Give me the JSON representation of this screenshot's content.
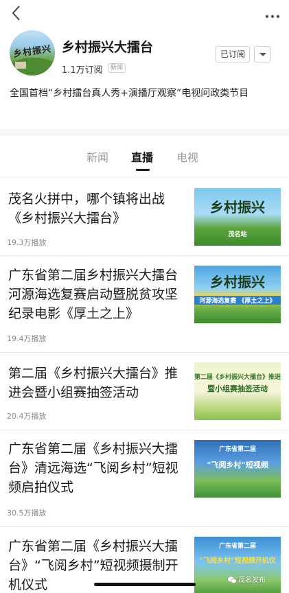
{
  "nav": {
    "back_icon": "chevron-left-icon",
    "more_icon": "more-dots-icon"
  },
  "channel": {
    "avatar_logo_text": "乡村振兴",
    "name": "乡村振兴大擂台",
    "subscribers": "1.1万订阅",
    "tag": "新闻",
    "subscribed_label": "已订阅",
    "description": "全国首档“乡村擂台真人秀+演播厅观察”电视问政类节目"
  },
  "tabs": [
    {
      "label": "新闻",
      "active": false
    },
    {
      "label": "直播",
      "active": true
    },
    {
      "label": "电视",
      "active": false
    }
  ],
  "feed": [
    {
      "title": "茂名火拼中，哪个镇将出战《乡村振兴大擂台》",
      "plays": "19.3万播放",
      "thumb": {
        "big": "乡村振兴",
        "banner": "茂名站",
        "sky": "#7ec9ef",
        "ground": "#5aa43c"
      }
    },
    {
      "title": "广东省第二届乡村振兴大擂台河源海选复赛启动暨脱贫攻坚纪录电影《厚土之上》",
      "plays": "19.4万播放",
      "thumb": {
        "big": "乡村振兴",
        "banner": "河源海选复赛 《厚土之上》",
        "sky": "#4ea7e0",
        "ground": "#6ab04c"
      }
    },
    {
      "title": "第二届《乡村振兴大擂台》推进会暨小组赛抽签活动",
      "plays": "20.4万播放",
      "thumb": {
        "big": "暨小组赛抽签活动",
        "banner": "第二届《乡村振兴大擂台》推进会",
        "sky": "#eef3cf",
        "ground": "#b8d77a"
      }
    },
    {
      "title": "广东省第二届《乡村振兴大擂台》清远海选“飞阅乡村”短视频启拍仪式",
      "plays": "30.5万播放",
      "thumb": {
        "big": "“飞阅乡村”短视频",
        "banner": "广东省第二届",
        "sky": "#2f6fb8",
        "ground": "#3f8f3a"
      }
    },
    {
      "title": "广东省第二届《乡村振兴大擂台》“飞阅乡村”短视频摄制开机仪式",
      "plays": "",
      "thumb": {
        "big": "“飞阅乡村”短视频开机仪",
        "banner": "广东省第二届",
        "sky": "#3a8fd6",
        "ground": "#4d9b3e"
      }
    }
  ],
  "watermark": "茂名发布"
}
